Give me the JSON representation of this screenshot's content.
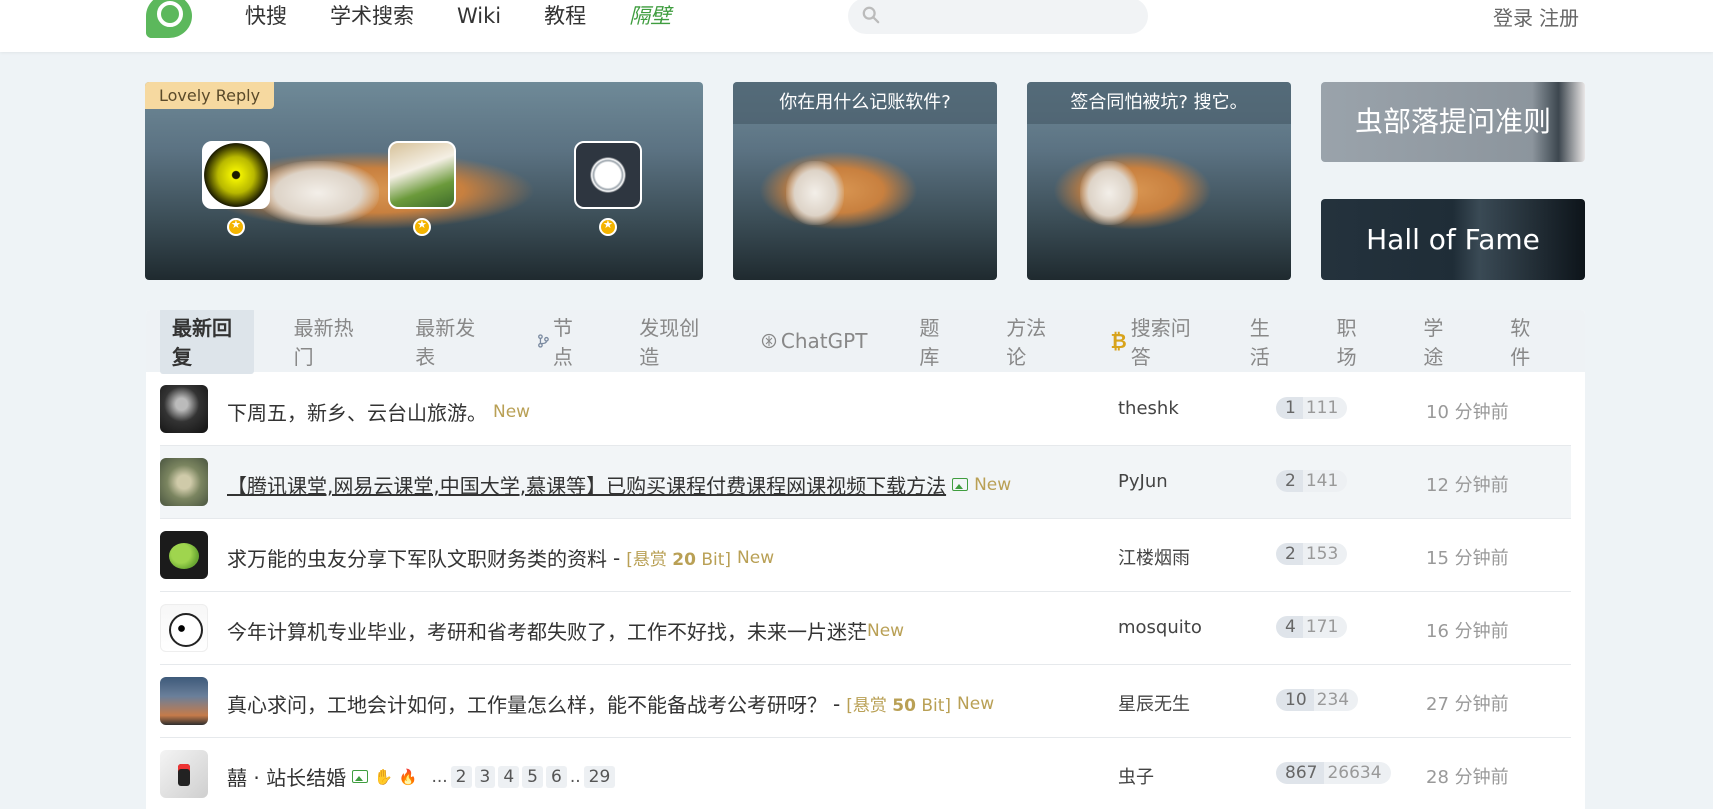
{
  "header": {
    "nav": [
      {
        "label": "快搜"
      },
      {
        "label": "学术搜索"
      },
      {
        "label": "Wiki"
      },
      {
        "label": "教程"
      },
      {
        "label": "隔壁"
      }
    ],
    "search": {
      "placeholder": "",
      "value": ""
    },
    "auth": {
      "login": "登录",
      "register": "注册"
    }
  },
  "banners": {
    "lovely_reply": {
      "tag": "Lovely Reply"
    },
    "caption_1": "你在用什么记账软件?",
    "caption_2": "签合同怕被坑? 搜它。",
    "rules_title": "虫部落提问准则",
    "hof_title": "Hall of Fame"
  },
  "tabs": [
    {
      "label": "最新回复",
      "active": true
    },
    {
      "label": "最新热门"
    },
    {
      "label": "最新发表"
    },
    {
      "label": "节点",
      "icon": "branch-icon"
    },
    {
      "label": "发现创造"
    },
    {
      "label": "ChatGPT",
      "icon": "chatgpt-icon"
    },
    {
      "label": "题库"
    },
    {
      "label": "方法论"
    },
    {
      "label": "搜索问答",
      "icon": "bitcoin-icon"
    },
    {
      "label": "生活"
    },
    {
      "label": "职场"
    },
    {
      "label": "学途"
    },
    {
      "label": "软件"
    }
  ],
  "topics": [
    {
      "title": "下周五，新乡、云台山旅游。",
      "new": "New",
      "author": "theshk",
      "replies": "1",
      "views": "111",
      "time": "10 分钟前"
    },
    {
      "title": "【腾讯课堂,网易云课堂,中国大学,慕课等】已购买课程付费课程网课视频下载方法",
      "new": "New",
      "author": "PyJun",
      "replies": "2",
      "views": "141",
      "time": "12 分钟前"
    },
    {
      "title": "求万能的虫友分享下军队文职财务类的资料",
      "bounty_prefix": "[悬赏",
      "bounty_amount": "20",
      "bounty_suffix": "Bit]",
      "new": "New",
      "author": "江楼烟雨",
      "replies": "2",
      "views": "153",
      "time": "15 分钟前"
    },
    {
      "title": "今年计算机专业毕业，考研和省考都失败了，工作不好找，未来一片迷茫",
      "new": "New",
      "author": "mosquito",
      "replies": "4",
      "views": "171",
      "time": "16 分钟前"
    },
    {
      "title": "真心求问，工地会计如何，工作量怎么样，能不能备战考公考研呀？",
      "bounty_prefix": "[悬赏",
      "bounty_amount": "50",
      "bounty_suffix": "Bit]",
      "new": "New",
      "author": "星辰无生",
      "replies": "10",
      "views": "234",
      "time": "27 分钟前"
    },
    {
      "title": "囍 · 站长结婚",
      "pages": [
        "2",
        "3",
        "4",
        "5",
        "6",
        "29"
      ],
      "author": "虫子",
      "replies": "867",
      "views": "26634",
      "time": "28 分钟前"
    }
  ],
  "colors": {
    "accent_green": "#3f9d3f",
    "bounty_gold": "#b9a055",
    "background": "#eef3f6"
  }
}
